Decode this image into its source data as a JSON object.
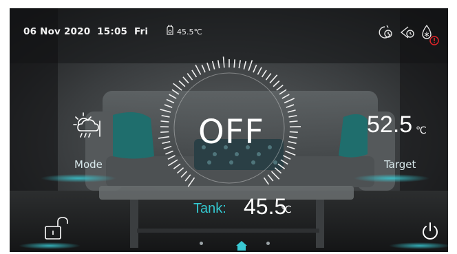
{
  "status_bar": {
    "date": "06 Nov 2020",
    "time": "15:05",
    "weekday": "Fri",
    "water_temp": "45.5℃",
    "icons": [
      "timer-icon",
      "schedule-icon",
      "defrost-icon"
    ],
    "alert_icon": "alert-icon"
  },
  "dial": {
    "state": "OFF"
  },
  "target": {
    "value": "52.5",
    "unit": "℃",
    "label": "Target"
  },
  "mode": {
    "label": "Mode",
    "icon": "weather-mode-icon"
  },
  "tank": {
    "label": "Tank:",
    "value": "45.5",
    "unit": "℃"
  },
  "bottom": {
    "lock_icon": "unlock-icon",
    "power_icon": "power-icon",
    "page_indicator": [
      "dot",
      "home",
      "dot"
    ]
  },
  "colors": {
    "accent": "#33c7cf",
    "alert": "#e0242a",
    "background": "#1b1d1e"
  }
}
